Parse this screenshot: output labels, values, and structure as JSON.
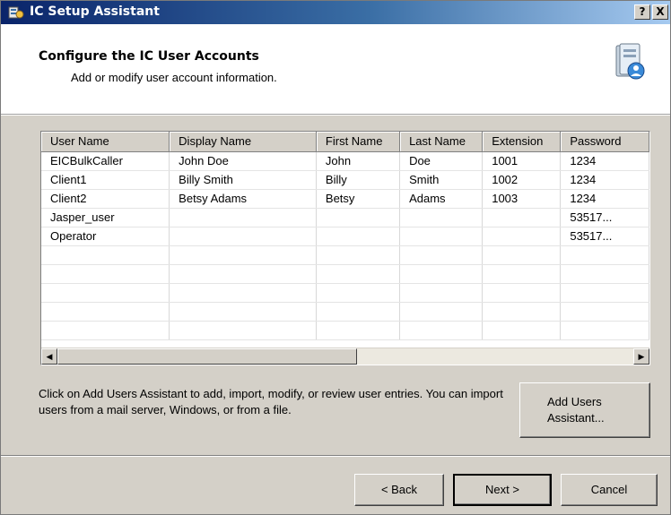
{
  "window": {
    "title": "IC Setup Assistant",
    "help_label": "?",
    "close_label": "X"
  },
  "header": {
    "title": "Configure the IC User Accounts",
    "subtitle": "Add or modify user account information."
  },
  "table": {
    "columns": [
      "User Name",
      "Display Name",
      "First Name",
      "Last Name",
      "Extension",
      "Password"
    ],
    "rows": [
      [
        "EICBulkCaller",
        "John Doe",
        "John",
        "Doe",
        "1001",
        "1234"
      ],
      [
        "Client1",
        "Billy Smith",
        "Billy",
        "Smith",
        "1002",
        "1234"
      ],
      [
        "Client2",
        "Betsy Adams",
        "Betsy",
        "Adams",
        "1003",
        "1234"
      ],
      [
        "Jasper_user",
        "",
        "",
        "",
        "",
        "53517..."
      ],
      [
        "Operator",
        "",
        "",
        "",
        "",
        "53517..."
      ],
      [
        "",
        "",
        "",
        "",
        "",
        ""
      ],
      [
        "",
        "",
        "",
        "",
        "",
        ""
      ],
      [
        "",
        "",
        "",
        "",
        "",
        ""
      ],
      [
        "",
        "",
        "",
        "",
        "",
        ""
      ],
      [
        "",
        "",
        "",
        "",
        "",
        ""
      ]
    ]
  },
  "instructions": "Click on Add Users Assistant to add, import, modify, or review user entries. You can import users from a mail server, Windows, or from a file.",
  "buttons": {
    "add_users_line1": "Add Users",
    "add_users_line2": "Assistant...",
    "back": "< Back",
    "next": "Next >",
    "cancel": "Cancel"
  },
  "icons": {
    "title_icon": "setup-assistant-icon",
    "header_icon": "user-accounts-icon",
    "scroll_left": "scroll-left-arrow-icon",
    "scroll_right": "scroll-right-arrow-icon"
  }
}
